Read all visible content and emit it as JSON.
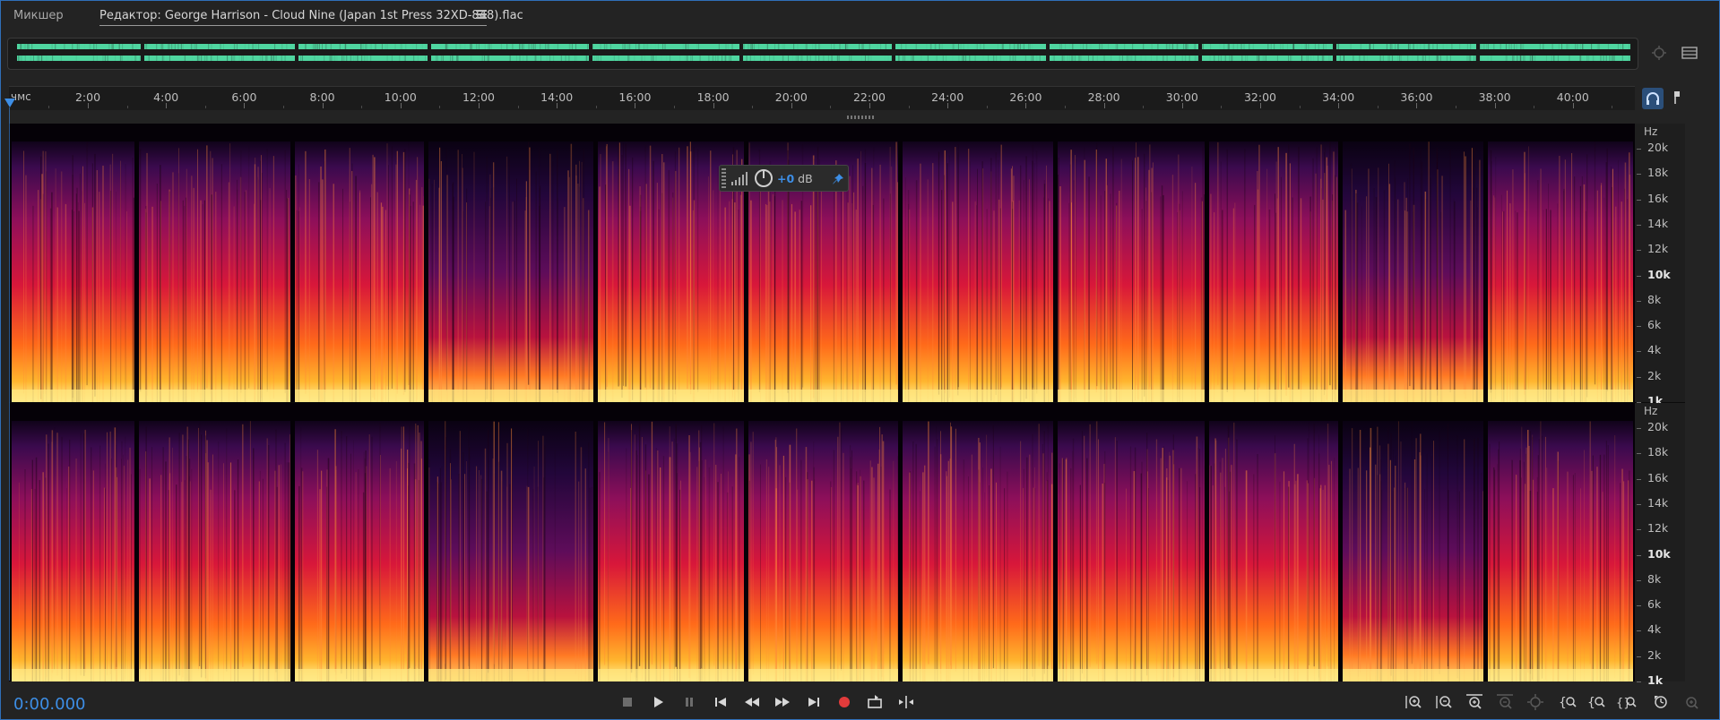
{
  "tabs": {
    "mixer_label": "Микшер",
    "editor_label": "Редактор: George Harrison - Cloud Nine (Japan 1st Press 32XD-848).flac"
  },
  "ruler": {
    "unit_label": "чмс",
    "labels": [
      "2:00",
      "4:00",
      "6:00",
      "8:00",
      "10:00",
      "12:00",
      "14:00",
      "16:00",
      "18:00",
      "20:00",
      "22:00",
      "24:00",
      "26:00",
      "28:00",
      "30:00",
      "32:00",
      "34:00",
      "36:00",
      "38:00",
      "40:00"
    ]
  },
  "frequency_axis": {
    "unit": "Hz",
    "labels": [
      "20k",
      "18k",
      "16k",
      "14k",
      "12k",
      "10k",
      "8k",
      "6k",
      "4k",
      "2k",
      "1k"
    ]
  },
  "hud": {
    "gain_value": "+0",
    "gain_unit": "dB"
  },
  "transport": {
    "timecode": "0:00.000"
  },
  "icons": {
    "tab_menu": "hamburger-icon",
    "overview_zoom": "zoom-overview-icon",
    "overview_panel": "panel-list-icon",
    "headphones": "headphones-icon",
    "pin_marker": "marker-pin-icon",
    "hud_meter": "level-meter-icon",
    "hud_knob": "gain-knob-icon",
    "hud_pin": "pin-icon"
  },
  "colors": {
    "accent": "#3d8ee6",
    "waveform": "#4fd6a0",
    "record": "#e23b3b",
    "background": "#232323"
  }
}
